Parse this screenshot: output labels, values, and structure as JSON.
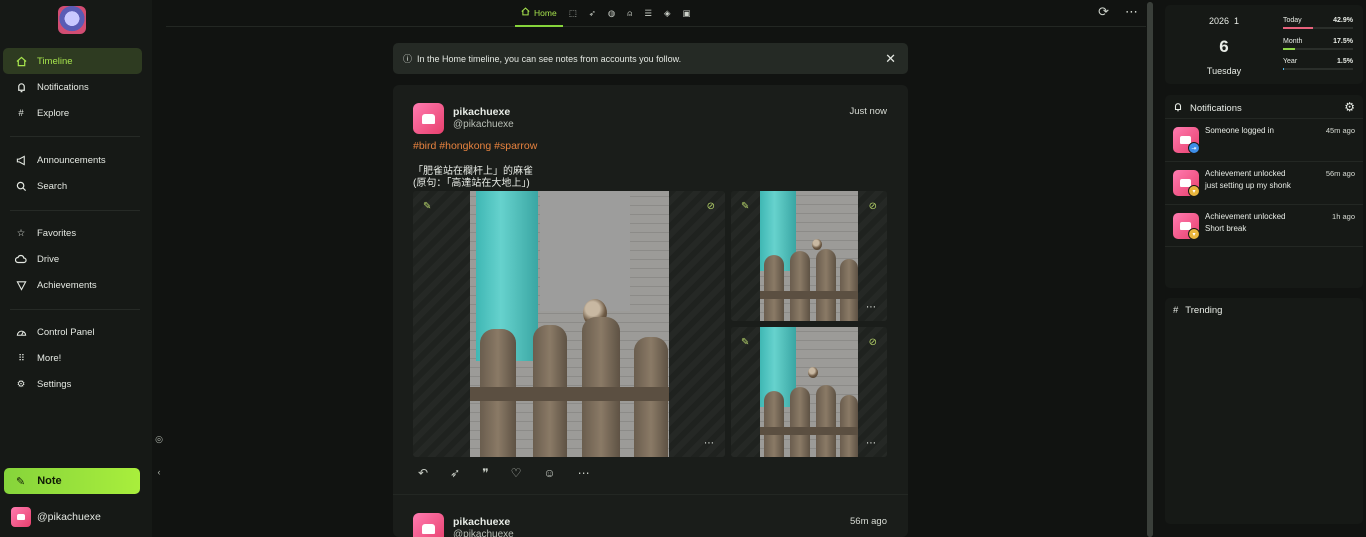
{
  "sidebar": {
    "items": [
      {
        "label": "Timeline",
        "icon": "home-icon"
      },
      {
        "label": "Notifications",
        "icon": "bell-icon"
      },
      {
        "label": "Explore",
        "icon": "hash-icon"
      },
      {
        "label": "Announcements",
        "icon": "megaphone-icon"
      },
      {
        "label": "Search",
        "icon": "search-icon"
      },
      {
        "label": "Favorites",
        "icon": "star-icon"
      },
      {
        "label": "Drive",
        "icon": "cloud-icon"
      },
      {
        "label": "Achievements",
        "icon": "medal-icon"
      },
      {
        "label": "Control Panel",
        "icon": "dashboard-icon"
      },
      {
        "label": "More!",
        "icon": "grid-icon"
      },
      {
        "label": "Settings",
        "icon": "gear-icon"
      }
    ],
    "note_label": "Note",
    "account": "@pikachuexe"
  },
  "topbar": {
    "home_tab": "Home"
  },
  "banner": {
    "text": "In the Home timeline, you can see notes from accounts you follow."
  },
  "notes": [
    {
      "name": "pikachuexe",
      "username": "@pikachuexe",
      "time": "Just now",
      "hashtags": "#bird #hongkong #sparrow",
      "text": "「肥雀站在欄杆上」的麻雀\n(原句：「高達站在大地上」)"
    },
    {
      "name": "pikachuexe",
      "username": "@pikachuexe",
      "time": "56m ago"
    }
  ],
  "calendar": {
    "year": "2026",
    "month": "1",
    "day": "6",
    "weekday": "Tuesday",
    "rows": [
      {
        "label": "Today",
        "percent": "42.9%",
        "value": 42.9,
        "color": "#e8627c"
      },
      {
        "label": "Month",
        "percent": "17.5%",
        "value": 17.5,
        "color": "#8fd64a"
      },
      {
        "label": "Year",
        "percent": "1.5%",
        "value": 1.5,
        "color": "#4db0e8"
      }
    ]
  },
  "notifications_widget": {
    "title": "Notifications",
    "items": [
      {
        "line1": "Someone logged in",
        "line2": "",
        "ago": "45m ago",
        "badge_color": "#3d8ee8"
      },
      {
        "line1": "Achievement unlocked",
        "line2": "just setting up my shonk",
        "ago": "56m ago",
        "badge_color": "#e8b53d"
      },
      {
        "line1": "Achievement unlocked",
        "line2": "Short break",
        "ago": "1h ago",
        "badge_color": "#e8b53d"
      }
    ]
  },
  "trending_widget": {
    "title": "Trending"
  }
}
